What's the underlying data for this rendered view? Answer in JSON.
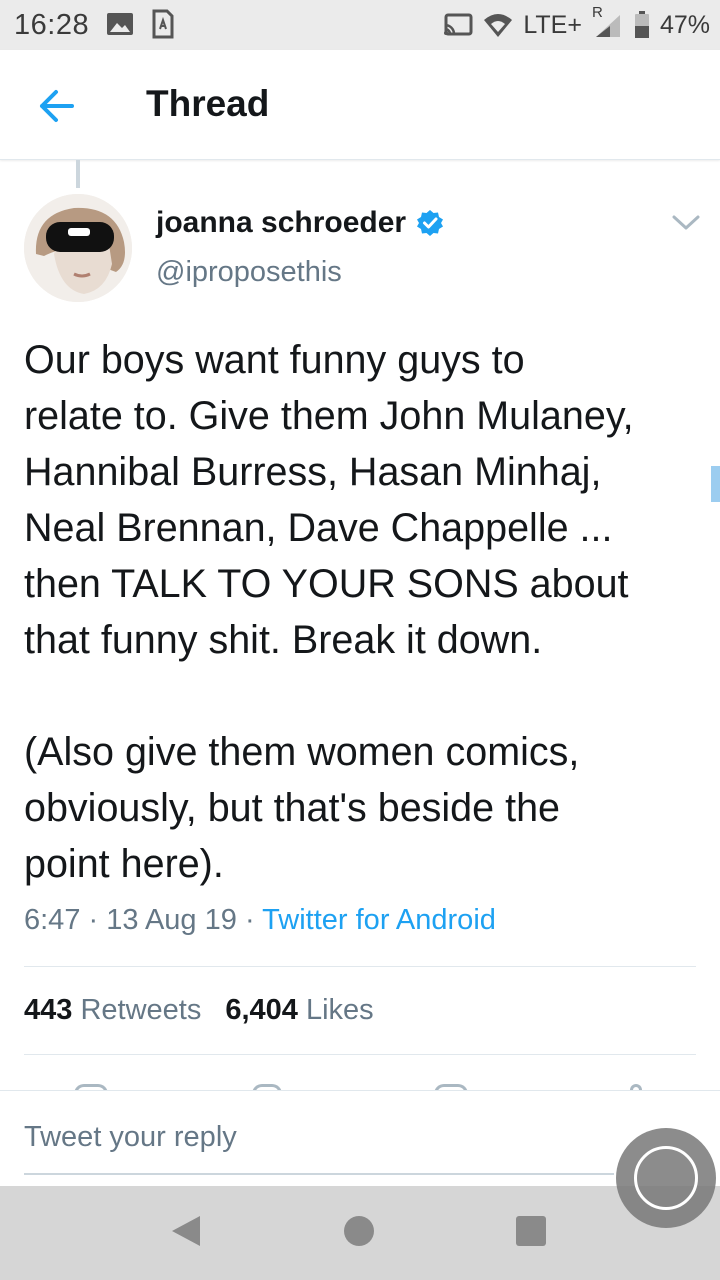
{
  "status_bar": {
    "time": "16:28",
    "network": "LTE+",
    "roaming": "R",
    "battery": "47%",
    "left_icons": [
      "image-icon",
      "sim-card-icon"
    ],
    "right_icons": [
      "cast-icon",
      "wifi-icon",
      "signal-icon",
      "battery-icon"
    ]
  },
  "app_bar": {
    "title": "Thread",
    "back_icon": "arrow-left-icon",
    "accent_color": "#1da1f2"
  },
  "tweet": {
    "author_name": "joanna schroeder",
    "verified": true,
    "handle": "@iproposethis",
    "text": "Our boys want funny guys to\nrelate to. Give them John Mulaney,\nHannibal Burress, Hasan Minhaj,\nNeal Brennan, Dave Chappelle ...\nthen TALK TO YOUR SONS about\nthat funny shit. Break it down.\n\n(Also give them women comics,\nobviously, but that's beside the\npoint here).",
    "time": "6:47",
    "date": "13 Aug 19",
    "separator": "·",
    "source": "Twitter for Android",
    "retweets_count": "443",
    "retweets_label": "Retweets",
    "likes_count": "6,404",
    "likes_label": "Likes"
  },
  "reply_bar": {
    "placeholder": "Tweet your reply"
  },
  "nav_bar": {
    "buttons": [
      "back-triangle-icon",
      "home-circle-icon",
      "recents-square-icon"
    ]
  }
}
